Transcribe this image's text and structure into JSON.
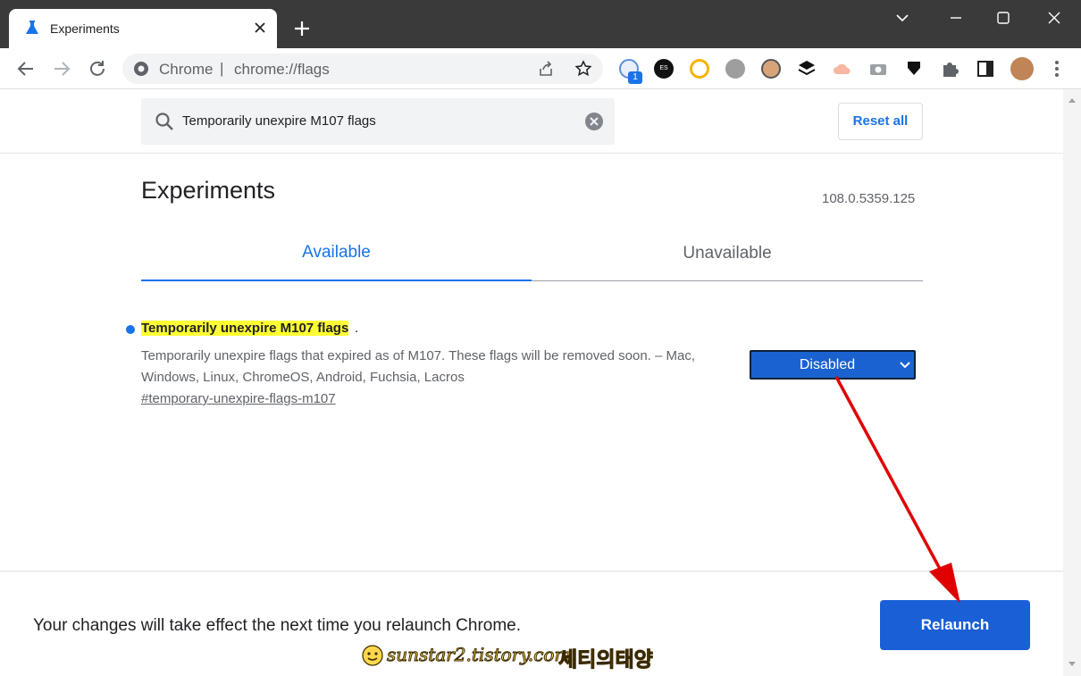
{
  "browser": {
    "tab_title": "Experiments",
    "omnibox_site": "Chrome",
    "omnibox_separator": "|",
    "omnibox_url": "chrome://flags",
    "extension_badge": "1"
  },
  "header": {
    "search_value": "Temporarily unexpire M107 flags",
    "reset_label": "Reset all"
  },
  "main": {
    "title": "Experiments",
    "version": "108.0.5359.125",
    "tabs": [
      {
        "label": "Available"
      },
      {
        "label": "Unavailable"
      }
    ],
    "flag": {
      "name": "Temporarily unexpire M107 flags",
      "period": ".",
      "description": "Temporarily unexpire flags that expired as of M107. These flags will be removed soon. – Mac, Windows, Linux, ChromeOS, Android, Fuchsia, Lacros",
      "link": "#temporary-unexpire-flags-m107",
      "selected": "Disabled"
    }
  },
  "footer": {
    "message": "Your changes will take effect the next time you relaunch Chrome.",
    "relaunch_label": "Relaunch"
  },
  "watermark": {
    "url": "sunstar2.tistory.com",
    "korean": "세티의태양"
  },
  "colors": {
    "accent": "#1a73e8",
    "highlight": "#ffff33",
    "arrow": "#e00000"
  }
}
